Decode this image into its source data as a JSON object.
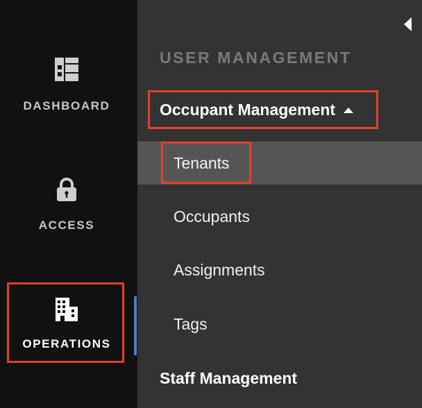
{
  "rail": {
    "items": [
      {
        "label": "DASHBOARD",
        "icon": "dashboard-icon"
      },
      {
        "label": "ACCESS",
        "icon": "lock-icon"
      },
      {
        "label": "OPERATIONS",
        "icon": "building-icon",
        "active": true
      }
    ]
  },
  "panel": {
    "collapse_icon": "caret-left-icon",
    "section_title": "USER MANAGEMENT",
    "groups": [
      {
        "label": "Occupant Management",
        "expanded": true,
        "caret_icon": "caret-up-icon",
        "items": [
          {
            "label": "Tenants",
            "active": true
          },
          {
            "label": "Occupants"
          },
          {
            "label": "Assignments"
          },
          {
            "label": "Tags"
          }
        ]
      },
      {
        "label": "Staff Management",
        "expanded": false
      }
    ]
  },
  "colors": {
    "rail_bg": "#111111",
    "panel_bg": "#333333",
    "active_item_bg": "#555555",
    "section_title": "#7a7a7a",
    "active_indicator": "#4d7fc4",
    "highlight": "#e2412c"
  }
}
